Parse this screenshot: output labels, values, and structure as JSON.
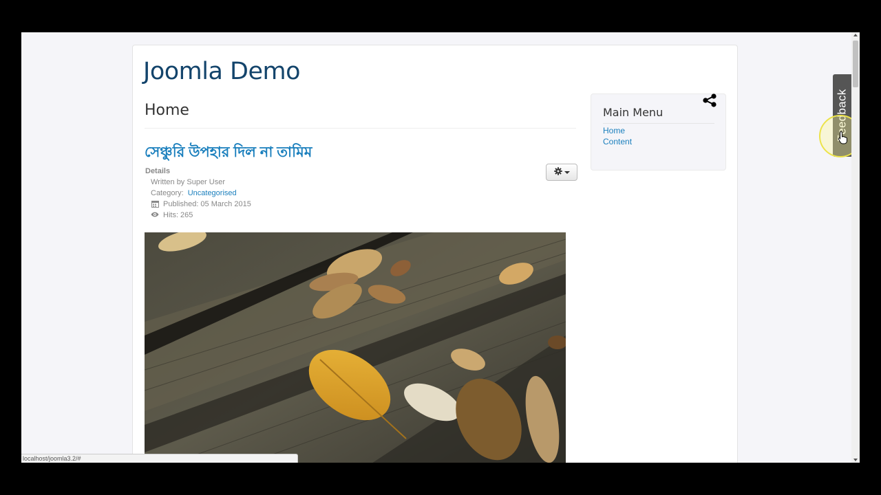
{
  "site": {
    "title": "Joomla Demo"
  },
  "page": {
    "heading": "Home"
  },
  "article": {
    "title": "সেঞ্চুরি উপহার দিল না তামিম",
    "details_label": "Details",
    "written_by": "Written by Super User",
    "category_label": "Category:",
    "category_value": "Uncategorised",
    "published": "Published: 05 March 2015",
    "hits": "Hits: 265"
  },
  "sidebar": {
    "title": "Main Menu",
    "items": [
      {
        "label": "Home"
      },
      {
        "label": "Content"
      }
    ]
  },
  "feedback": {
    "label": "Feedback"
  },
  "statusbar": {
    "url": "localhost/joomla3.2/#"
  },
  "icons": {
    "tools": "gear-icon",
    "share": "share-icon",
    "published": "calendar-icon",
    "hits": "eye-icon"
  },
  "colors": {
    "title": "#13446b",
    "link": "#1a7fbd",
    "feedback_tab": "#555555"
  }
}
